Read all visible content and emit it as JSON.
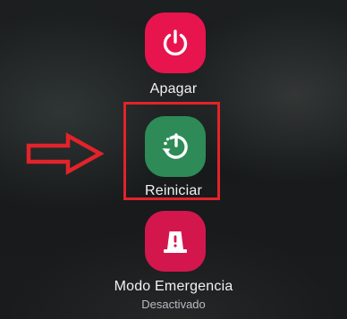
{
  "power_menu": {
    "items": [
      {
        "label": "Apagar",
        "icon": "power-icon",
        "color": "#e8144e"
      },
      {
        "label": "Reiniciar",
        "icon": "restart-icon",
        "color": "#2e8b57"
      },
      {
        "label": "Modo Emergencia",
        "sublabel": "Desactivado",
        "icon": "emergency-beacon-icon",
        "color": "#d3174d"
      }
    ]
  },
  "annotation": {
    "color": "#e3232a",
    "highlighted_item": "Reiniciar",
    "arrow": "right-arrow-icon"
  }
}
